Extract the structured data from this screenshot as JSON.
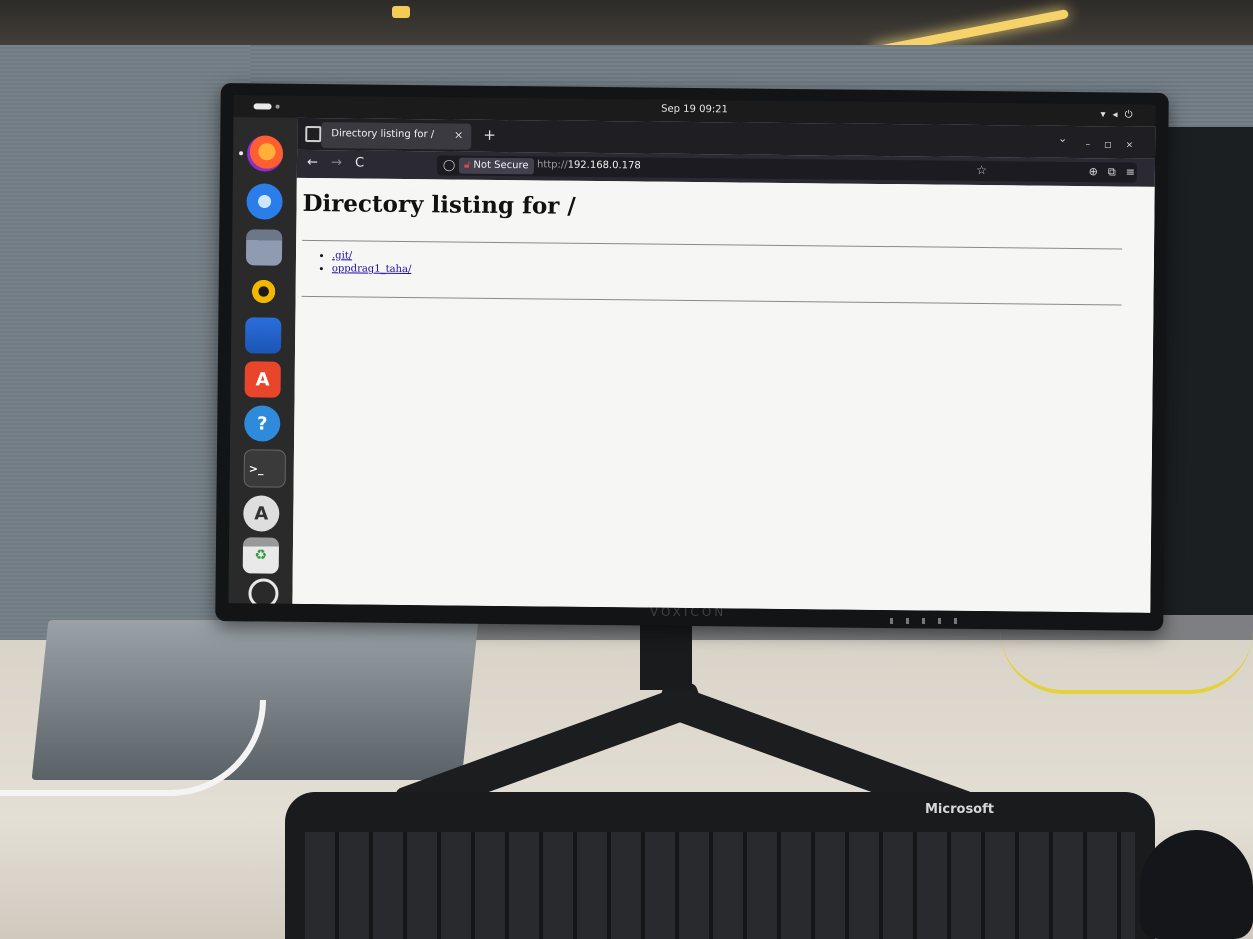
{
  "topbar": {
    "clock": "Sep 19 09:21",
    "tray_icons": [
      "wifi-icon",
      "volume-icon",
      "power-icon"
    ]
  },
  "dock": {
    "items": [
      {
        "name": "firefox",
        "icon": "firefox-icon",
        "active": true
      },
      {
        "name": "thunderbird",
        "icon": "thunderbird-icon"
      },
      {
        "name": "files",
        "icon": "files-icon"
      },
      {
        "name": "rhythmbox",
        "icon": "rhythmbox-icon"
      },
      {
        "name": "libreoffice-writer",
        "icon": "writer-icon"
      },
      {
        "name": "app-center",
        "icon": "app-center-icon",
        "glyph": "A"
      },
      {
        "name": "help",
        "icon": "help-icon",
        "glyph": "?"
      },
      {
        "name": "terminal",
        "icon": "terminal-icon",
        "glyph": ">_"
      },
      {
        "name": "software-updater",
        "icon": "updater-icon",
        "glyph": "A"
      },
      {
        "name": "trash",
        "icon": "trash-icon",
        "glyph": "♻"
      },
      {
        "name": "show-apps",
        "icon": "ubuntu-apps-icon"
      }
    ]
  },
  "browser": {
    "tab": {
      "title": "Directory listing for /",
      "close": "×"
    },
    "new_tab": "+",
    "urlbar": {
      "security": "Not Secure",
      "scheme": "http://",
      "host": "192.168.0.178"
    },
    "page": {
      "title": "Directory listing for /",
      "entries": [
        ".git/",
        "oppdrag1_taha/"
      ]
    }
  },
  "hardware": {
    "keyboard_brand": "Microsoft",
    "monitor_brand": "VOXICON"
  },
  "colors": {
    "link": "#1a0dab",
    "not_secure_lock": "#e84a4a",
    "firefox_toolbar": "#2b2a33"
  }
}
